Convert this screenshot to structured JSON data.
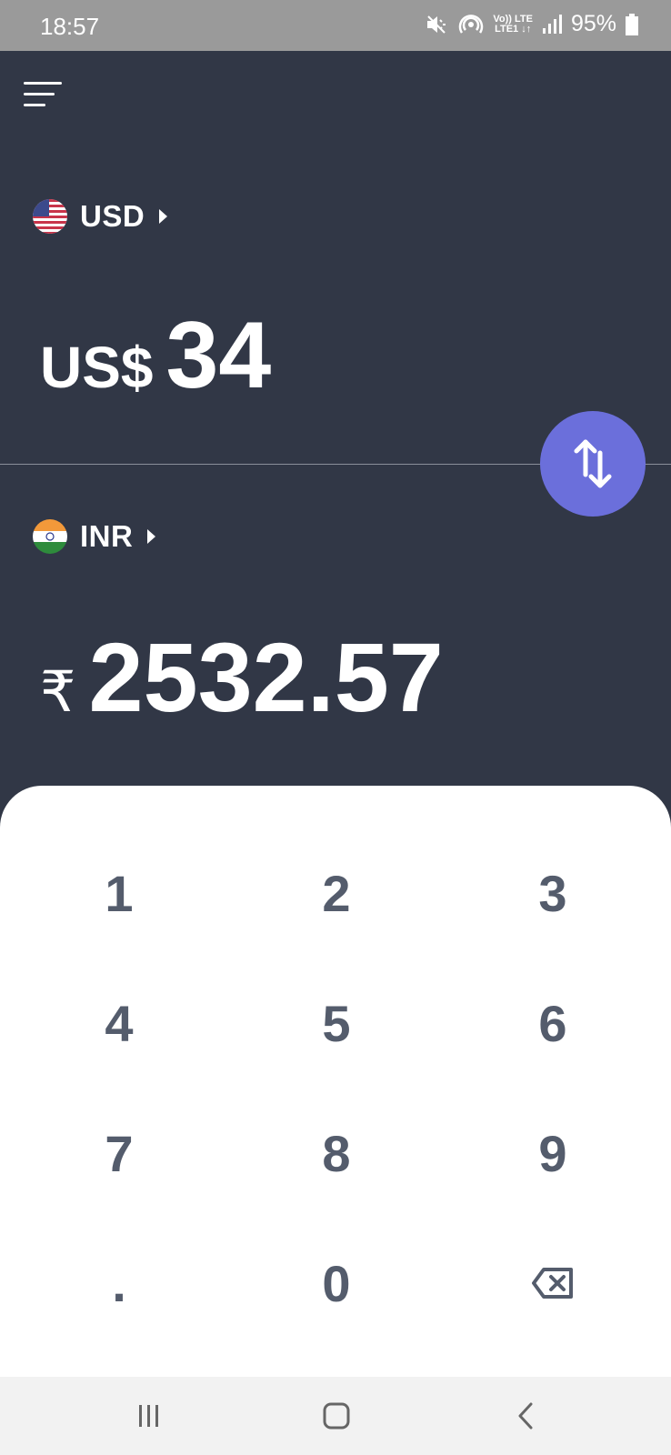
{
  "status_bar": {
    "time": "18:57",
    "lte_top": "Vo)) LTE",
    "lte_bottom": "LTE1 ↓↑",
    "battery": "95%"
  },
  "header": {
    "menu_icon": "hamburger-menu-icon"
  },
  "from_currency": {
    "code": "USD",
    "flag_icon": "us-flag-icon",
    "symbol": "US$",
    "amount": "34"
  },
  "to_currency": {
    "code": "INR",
    "flag_icon": "india-flag-icon",
    "symbol": "₹",
    "amount": "2532.57"
  },
  "swap_button": {
    "icon": "swap-vertical-arrows-icon",
    "color": "#6b6fdb"
  },
  "keypad": {
    "keys": [
      "1",
      "2",
      "3",
      "4",
      "5",
      "6",
      "7",
      "8",
      "9",
      ".",
      "0"
    ],
    "backspace_icon": "backspace-icon"
  },
  "nav_bar": {
    "recents_icon": "recents-icon",
    "home_icon": "home-icon",
    "back_icon": "back-icon"
  },
  "colors": {
    "background": "#313746",
    "keypad_background": "#ffffff",
    "key_text": "#545c6c",
    "accent": "#6b6fdb"
  }
}
